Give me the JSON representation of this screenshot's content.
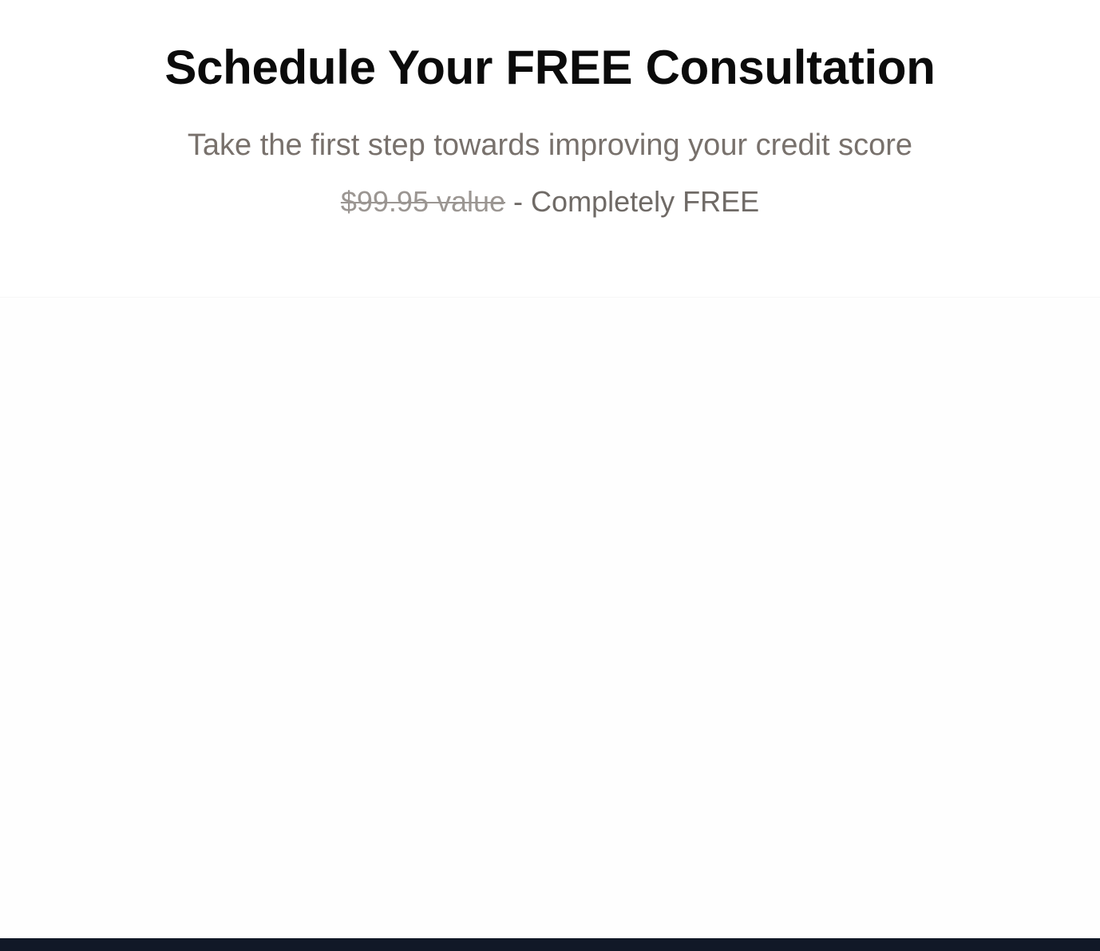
{
  "hero": {
    "title": "Schedule Your FREE Consultation",
    "subtitle": "Take the first step towards improving your credit score",
    "price_old": "$99.95 value",
    "price_separator": " - ",
    "price_new": "Completely FREE"
  },
  "colors": {
    "title": "#0b0b0b",
    "muted_text": "#78716c",
    "strikethrough_text": "#9b9692",
    "footer": "#111827"
  }
}
